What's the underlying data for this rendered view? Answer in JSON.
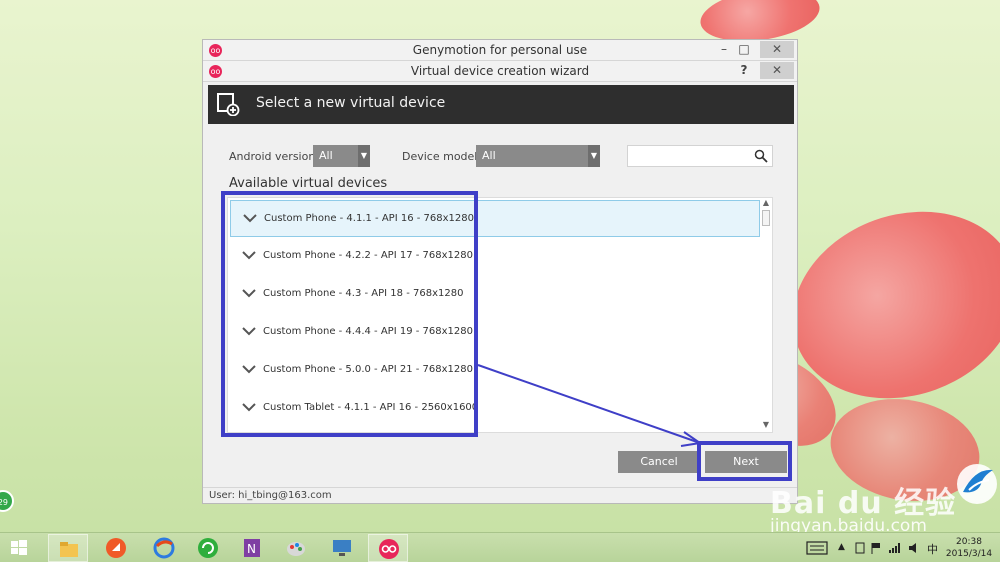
{
  "outer_window": {
    "title": "Genymotion for personal use",
    "minimize": "–",
    "maximize": "□",
    "close": "✕"
  },
  "wizard_window": {
    "title": "Virtual device creation wizard",
    "help": "?",
    "close": "✕"
  },
  "header": {
    "title": "Select a new virtual device",
    "icon": "add-device-icon"
  },
  "filters": {
    "android_version_label": "Android version:",
    "android_version_value": "All",
    "device_model_label": "Device model:",
    "device_model_value": "All",
    "search_value": "",
    "search_placeholder": ""
  },
  "list": {
    "title": "Available virtual devices",
    "items": [
      {
        "label": "Custom Phone - 4.1.1 - API 16 - 768x1280",
        "selected": true
      },
      {
        "label": "Custom Phone - 4.2.2 - API 17 - 768x1280",
        "selected": false
      },
      {
        "label": "Custom Phone - 4.3 - API 18 - 768x1280",
        "selected": false
      },
      {
        "label": "Custom Phone - 4.4.4 - API 19 - 768x1280",
        "selected": false
      },
      {
        "label": "Custom Phone - 5.0.0 - API 21 - 768x1280",
        "selected": false
      },
      {
        "label": "Custom Tablet - 4.1.1 - API 16 - 2560x1600",
        "selected": false
      }
    ]
  },
  "buttons": {
    "cancel": "Cancel",
    "next": "Next"
  },
  "status": {
    "user": "User: hi_tbing@163.com"
  },
  "desktop": {
    "badge": "29",
    "watermark": "Bai du 经验",
    "watermark_sub": "jingyan.baidu.com"
  },
  "taskbar": {
    "clock_time": "20:38",
    "clock_date": "2015/3/14",
    "tray_ime": "中"
  },
  "colors": {
    "annotation": "#3f3fc7",
    "header_bg": "#2e2e2e",
    "button_bg": "#8a8a8a",
    "selected_bg": "#e6f4fb",
    "genymotion_red": "#e8255a"
  }
}
